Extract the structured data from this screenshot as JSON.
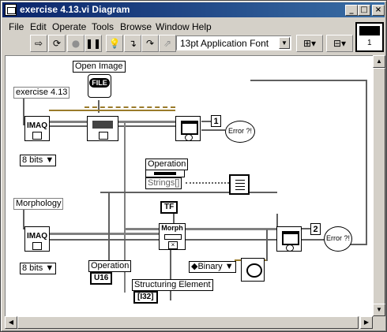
{
  "window": {
    "title": "exercise 4.13.vi Diagram"
  },
  "menu": [
    "File",
    "Edit",
    "Operate",
    "Tools",
    "Browse",
    "Window",
    "Help"
  ],
  "toolbar": {
    "font": "13pt Application Font"
  },
  "iconpane": {
    "number": "1"
  },
  "diagram": {
    "open_image": "Open Image",
    "file_icon": "FILE",
    "exercise_label": "exercise 4.13",
    "imaq1": "IMAQ",
    "bits1": "8 bits",
    "indicator1": "1",
    "error1": "Error ?!",
    "operation_ctrl_label": "Operation",
    "strings_label": "Strings[]",
    "morphology_label": "Morphology",
    "imaq2": "IMAQ",
    "bits2": "8 bits",
    "tf": "TF",
    "morph": "Morph",
    "indicator2": "2",
    "error2": "Error ?!",
    "operation_label": "Operation",
    "u16": "U16",
    "binary": "Binary",
    "struct_label": "Structuring Element",
    "i32": "[I32]"
  }
}
